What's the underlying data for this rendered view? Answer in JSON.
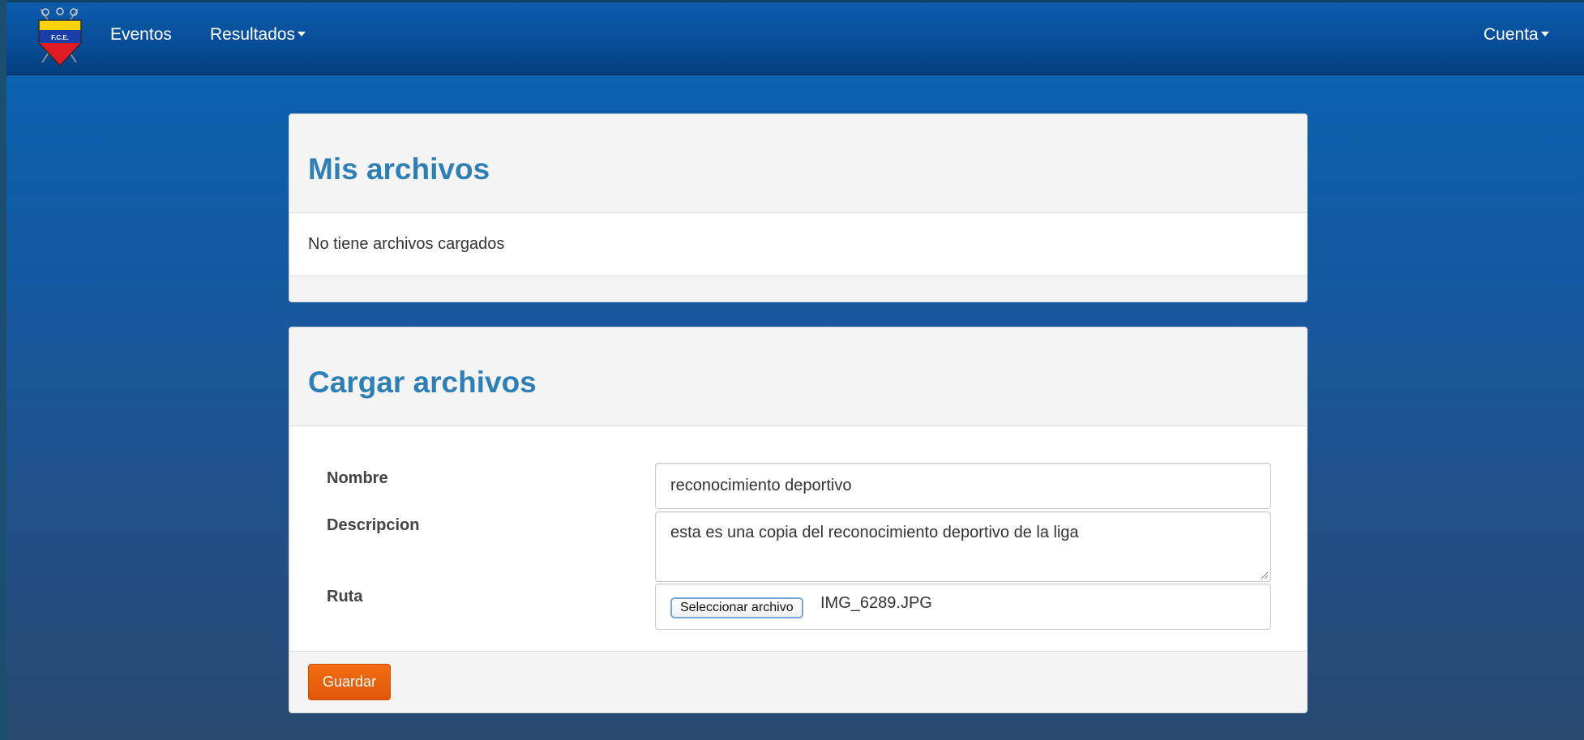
{
  "navbar": {
    "logo_text": "F.C.E.",
    "links": [
      {
        "label": "Eventos"
      },
      {
        "label": "Resultados"
      }
    ],
    "account_label": "Cuenta"
  },
  "files_panel": {
    "title": "Mis archivos",
    "empty_message": "No tiene archivos cargados"
  },
  "upload_panel": {
    "title": "Cargar archivos",
    "fields": {
      "nombre_label": "Nombre",
      "nombre_value": "reconocimiento deportivo",
      "descripcion_label": "Descripcion",
      "descripcion_value": "esta es una copia del reconocimiento deportivo de la liga",
      "ruta_label": "Ruta",
      "file_button_label": "Seleccionar archivo",
      "file_name": "IMG_6289.JPG"
    },
    "save_label": "Guardar"
  },
  "colors": {
    "navbar": "#074f9c",
    "panel_title": "#2f7fb7",
    "save_button": "#e9620d",
    "background_top": "#0a66b3",
    "background_bottom": "#284970"
  }
}
